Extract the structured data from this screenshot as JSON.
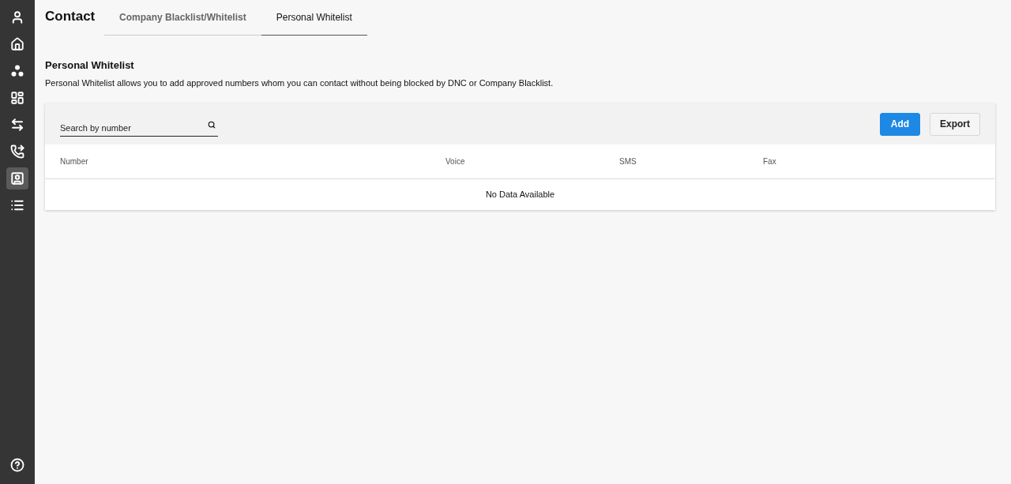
{
  "sidebar": {
    "top": [
      {
        "kind": "user",
        "selected": false
      },
      {
        "kind": "home",
        "selected": false
      },
      {
        "kind": "group",
        "selected": false
      },
      {
        "kind": "dashboard",
        "selected": false
      },
      {
        "kind": "transfer",
        "selected": false
      },
      {
        "kind": "phone",
        "selected": false
      },
      {
        "kind": "contact",
        "selected": true
      },
      {
        "kind": "list",
        "selected": false
      }
    ],
    "bottom": [
      {
        "kind": "help",
        "selected": false
      }
    ]
  },
  "header": {
    "title": "Contact",
    "tabs": [
      {
        "label": "Company Blacklist/Whitelist",
        "selected": false
      },
      {
        "label": "Personal Whitelist",
        "selected": true
      }
    ]
  },
  "section": {
    "title": "Personal Whitelist",
    "description": "Personal Whitelist allows you to add approved numbers whom you can contact without being blocked by DNC or Company Blacklist."
  },
  "toolbar": {
    "search": {
      "placeholder": "Search by number"
    },
    "buttons": [
      {
        "label": "Add",
        "kind": "primary"
      },
      {
        "label": "Export",
        "kind": "outline"
      }
    ]
  },
  "table": {
    "columns": [
      "Number",
      "Voice",
      "SMS",
      "Fax"
    ],
    "empty_text": "No Data Available"
  }
}
